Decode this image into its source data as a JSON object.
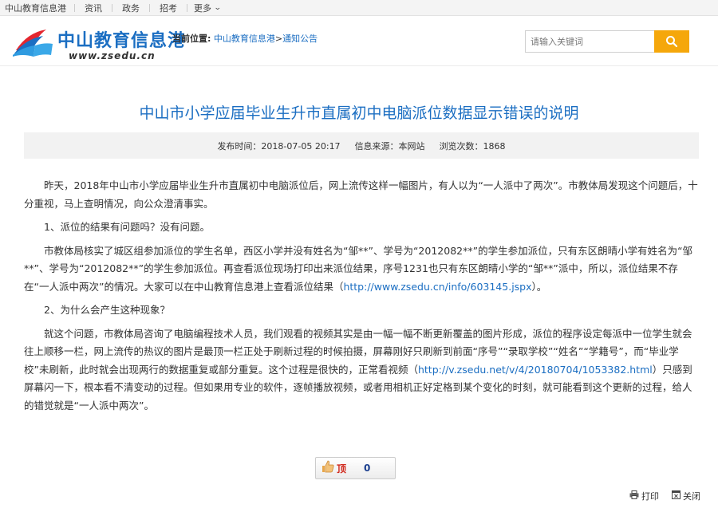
{
  "topbar": {
    "site_name": "中山教育信息港",
    "nav": [
      "资讯",
      "政务",
      "招考"
    ],
    "more_label": "更多"
  },
  "header": {
    "logo_cn": "中山教育信息港",
    "logo_en": "www.zsedu.cn",
    "location_label": "当前位置:",
    "breadcrumb_home": "中山教育信息港",
    "breadcrumb_sep": ">",
    "breadcrumb_current": "通知公告",
    "search_placeholder": "请输入关键词",
    "search_icon": "search-icon",
    "accent_color": "#f5a70b",
    "link_color": "#1b6ec2"
  },
  "article": {
    "title": "中山市小学应届毕业生升市直属初中电脑派位数据显示错误的说明",
    "publish_time": "发布时间：2018-07-05 20:17",
    "source": "信息来源：本网站",
    "views": "浏览次数：1868",
    "p1": "昨天，2018年中山市小学应届毕业生升市直属初中电脑派位后，网上流传这样一幅图片，有人以为“一人派中了两次”。市教体局发现这个问题后，十分重视，马上查明情况，向公众澄清事实。",
    "p2": "1、派位的结果有问题吗？没有问题。",
    "p3_a": "市教体局核实了城区组参加派位的学生名单，西区小学并没有姓名为“邹**”、学号为“2012082**”的学生参加派位，只有东区朗晴小学有姓名为“邹**”、学号为“2012082**”的学生参加派位。再查看派位现场打印出来派位结果，序号1231也只有东区朗晴小学的“邹**”派中，所以，派位结果不存在“一人派中两次”的情况。大家可以在中山教育信息港上查看派位结果（",
    "p3_link": "http://www.zsedu.cn/info/603145.jspx",
    "p3_b": "）。",
    "p4": "2、为什么会产生这种现象？",
    "p5_a": "就这个问题，市教体局咨询了电脑编程技术人员，我们观看的视频其实是由一幅一幅不断更新覆盖的图片形成，派位的程序设定每派中一位学生就会往上顺移一栏，网上流传的热议的图片是最顶一栏正处于刷新过程的时候拍摄，屏幕刚好只刷新到前面“序号”“录取学校”“姓名”“学籍号”，而“毕业学校”未刷新，此时就会出现两行的数据重复或部分重复。这个过程是很快的，正常看视频（",
    "p5_link": "http://v.zsedu.net/v/4/20180704/1053382.html",
    "p5_b": "）只感到屏幕闪一下，根本看不清变动的过程。但如果用专业的软件，逐帧播放视频，或者用相机正好定格到某个变化的时刻，就可能看到这个更新的过程，给人的错觉就是“一人派中两次”。"
  },
  "like": {
    "icon": "thumbs-up-icon",
    "label": "顶",
    "count": "0"
  },
  "tools": {
    "print_label": "打印",
    "close_label": "关闭"
  }
}
